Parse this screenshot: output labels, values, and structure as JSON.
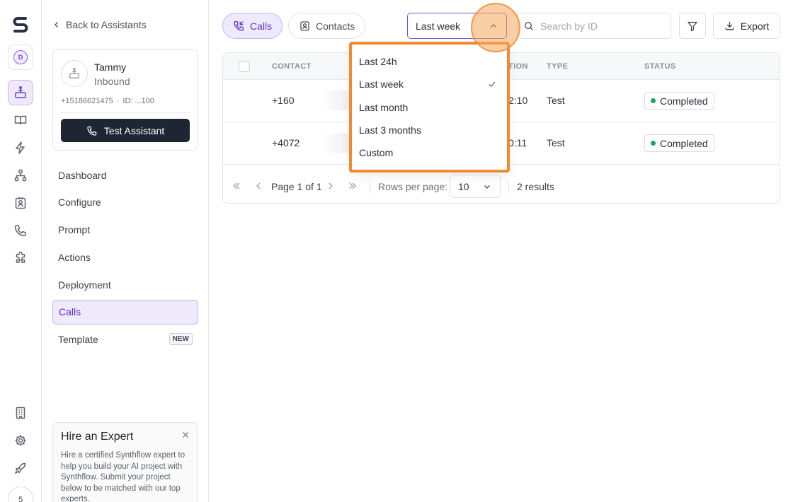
{
  "rail": {
    "workspace_initial": "D",
    "bottom_badge": "5"
  },
  "sidebar": {
    "back_label": "Back to Assistants",
    "assistant": {
      "name": "Tammy",
      "direction": "Inbound",
      "phone": "+15186621475",
      "separator": "·",
      "id": "ID: ...100"
    },
    "test_button": "Test Assistant",
    "nav": [
      {
        "label": "Dashboard"
      },
      {
        "label": "Configure"
      },
      {
        "label": "Prompt"
      },
      {
        "label": "Actions"
      },
      {
        "label": "Deployment"
      },
      {
        "label": "Calls",
        "active": true
      },
      {
        "label": "Template",
        "badge": "NEW"
      }
    ],
    "hire": {
      "title": "Hire an Expert",
      "body": "Hire a certified Synthflow expert to help you build your AI project with Synthflow. Submit your project below to be matched with our top experts."
    }
  },
  "toolbar": {
    "tabs": [
      {
        "label": "Calls",
        "active": true
      },
      {
        "label": "Contacts"
      }
    ],
    "range_value": "Last week",
    "search_placeholder": "Search by ID",
    "export_label": "Export"
  },
  "dropdown": {
    "options": [
      "Last 24h",
      "Last week",
      "Last month",
      "Last 3 months",
      "Custom"
    ],
    "selected": "Last week"
  },
  "table": {
    "headers": {
      "contact": "CONTACT",
      "duration_partial": "TION",
      "type": "TYPE",
      "status": "STATUS"
    },
    "rows": [
      {
        "contact": "+160",
        "duration": "2:10",
        "type": "Test",
        "status": "Completed"
      },
      {
        "contact": "+4072",
        "duration": "0:11",
        "type": "Test",
        "status": "Completed"
      }
    ],
    "pager": {
      "page_text": "Page 1 of 1",
      "rows_label": "Rows per page:",
      "rows_value": "10",
      "results": "2 results"
    }
  },
  "colors": {
    "accent": "#6d3fd1",
    "accent_bg": "#efe9fc",
    "highlight": "#ef8a2e",
    "status_ok": "#22a35a",
    "dark_button": "#1e2533"
  }
}
